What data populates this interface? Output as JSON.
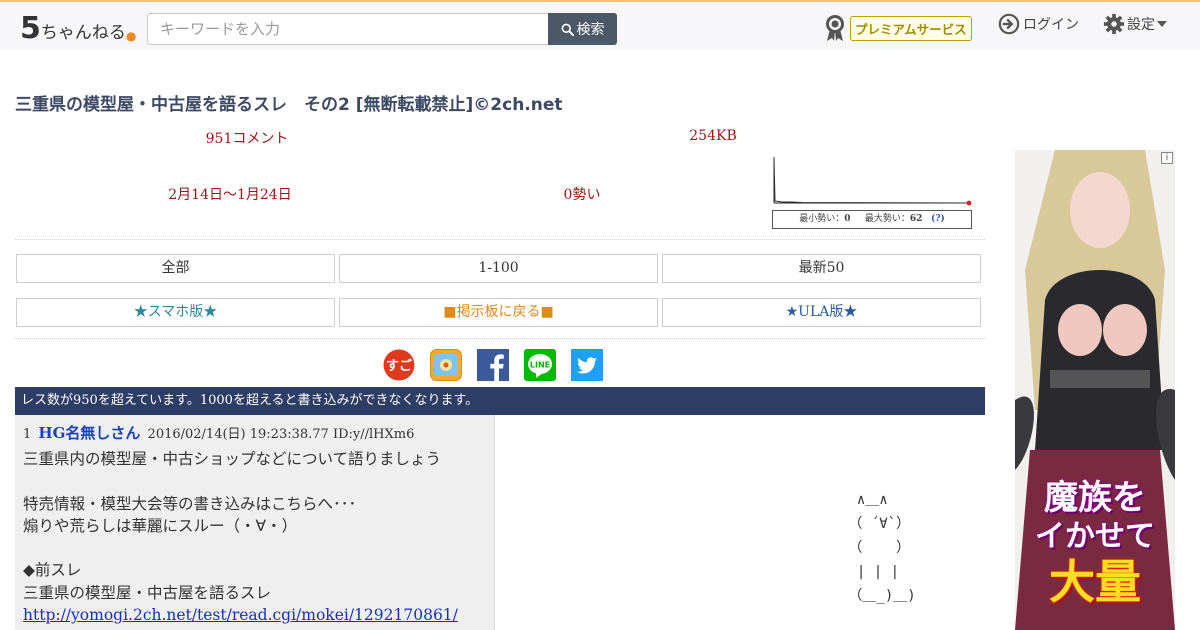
{
  "header": {
    "logo_number": "5",
    "logo_text": "ちゃんねる",
    "search_placeholder": "キーワードを入力",
    "search_button_label": "検索",
    "premium_label": "プレミアムサービス",
    "login_label": "ログイン",
    "settings_label": "設定"
  },
  "thread": {
    "title": "三重県の模型屋・中古屋を語るスレ　その2 [無断転載禁止]©2ch.net",
    "comments": "951コメント",
    "size": "254KB",
    "date_range": "2月14日〜1月24日",
    "speed": "0勢い",
    "speed_summary": {
      "min_label": "最小勢い：",
      "min_value": "0",
      "max_label": "最大勢い：",
      "max_value": "62",
      "help": "(?)"
    }
  },
  "nav": {
    "all": "全部",
    "range": "1-100",
    "latest": "最新50",
    "smartphone": "★スマホ版★",
    "back_to_board": "■掲示板に戻る■",
    "ula": "★ULA版★"
  },
  "share": {
    "icons": [
      "sugoi-icon",
      "share-app-icon",
      "facebook-icon",
      "line-icon",
      "twitter-icon"
    ],
    "line_label": "LINE"
  },
  "notice": "レス数が950を超えています。1000を超えると書き込みができなくなります。",
  "post": {
    "number": "1",
    "name": "HG名無しさん",
    "datetime": "2016/02/14(日) 19:23:38.77",
    "id": "ID:y//lHXm6",
    "lines": [
      "三重県内の模型屋・中古ショップなどについて語りましょう",
      "",
      "特売情報・模型大会等の書き込みはこちらへ･･･",
      "煽りや荒らしは華麗にスルー（・∀・）",
      "",
      "◆前スレ",
      "三重県の模型屋・中古屋を語るスレ"
    ],
    "link": "http://yomogi.2ch.net/test/read.cgi/mokei/1292170861/",
    "ascii_art": "  ∧＿∧\n （ ´∀`）\n （    ）\n  | | |\n （＿_)＿)"
  },
  "ad": {
    "info": "i",
    "line1": "魔族を",
    "line2": "イかせて",
    "line3": "大量"
  },
  "colors": {
    "notice_bg": "#2e3d66",
    "stat_red": "#a01515",
    "name_blue": "#1a3fc0",
    "premium_gold": "#a08c00"
  }
}
